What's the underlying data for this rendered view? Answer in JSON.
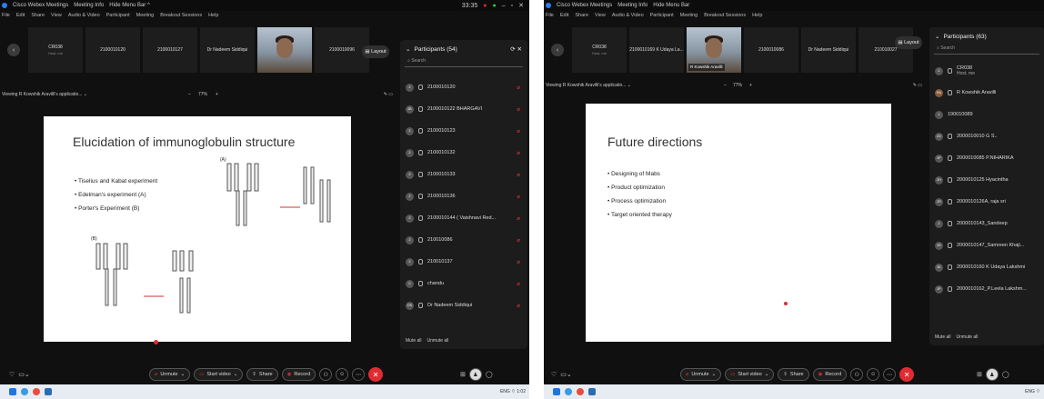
{
  "left": {
    "title": "Cisco Webex Meetings",
    "meeting_info": "Meeting Info",
    "hide_menu": "Hide Menu Bar ^",
    "timer": "33:35",
    "menus": [
      "File",
      "Edit",
      "Share",
      "View",
      "Audio & Video",
      "Participant",
      "Meeting",
      "Breakout Sessions",
      "Help"
    ],
    "thumbs": [
      {
        "name": "CR038",
        "sub": "Host, me"
      },
      {
        "name": "2100010120",
        "sub": ""
      },
      {
        "name": "2100010127",
        "sub": ""
      },
      {
        "name": "Dr Nadeem Siddiqui",
        "sub": ""
      },
      {
        "name": "",
        "sub": "",
        "video": true
      },
      {
        "name": "2100010096",
        "sub": ""
      }
    ],
    "layout": "Layout",
    "viewing": "Viewing R Kowshik Aravilli's applicatio...",
    "zoom": "77%",
    "slide": {
      "title": "Elucidation of immunoglobulin structure",
      "bullets": [
        "Tiselius and Kabat experiment",
        "Edelman's experiment (A)",
        "Porter's Experiment (B)"
      ],
      "label_a": "(A)",
      "label_b": "(B)"
    },
    "participants": {
      "header": "Participants (54)",
      "search": "Search",
      "rows": [
        "2100010120",
        "2100010122 BHARGAVI",
        "2100010123",
        "2100010132",
        "2100010133",
        "2100010136",
        "2100010144 ( Vaishnavi Red...",
        "210010086",
        "210010137",
        "chandu",
        "Dr Nadeem Siddiqui"
      ],
      "mute_all": "Mute all",
      "unmute_all": "Unmute all"
    },
    "controls": {
      "unmute": "Unmute",
      "start_video": "Start video",
      "share": "Share",
      "record": "Record"
    },
    "clock_time": "1:02",
    "clock_lang": "ENG"
  },
  "right": {
    "title": "Cisco Webex Meetings",
    "meeting_info": "Meeting Info",
    "hide_menu": "Hide Menu Bar",
    "menus": [
      "File",
      "Edit",
      "Share",
      "View",
      "Audio & Video",
      "Participant",
      "Meeting",
      "Breakout Sessions",
      "Help"
    ],
    "thumbs": [
      {
        "name": "CR038",
        "sub": "Host, me"
      },
      {
        "name": "2100010169 K Udaya La...",
        "sub": ""
      },
      {
        "name": "",
        "sub": "",
        "video": true,
        "cap": "R Kowshik Aravilli"
      },
      {
        "name": "2100010086",
        "sub": ""
      },
      {
        "name": "Dr Nadeem Siddiqui",
        "sub": ""
      },
      {
        "name": "210010027",
        "sub": ""
      }
    ],
    "layout": "Layout",
    "viewing": "Viewing R Kowshik Aravilli's applicatio...",
    "zoom": "77%",
    "slide": {
      "title": "Future directions",
      "bullets": [
        "Designing of Mabs",
        "Product optimization",
        "Process optimization",
        "Target oriented therapy"
      ]
    },
    "participants": {
      "header": "Participants (63)",
      "search": "Search",
      "rows": [
        "CR038",
        "R Kowshik Aravilli",
        "190010089",
        "2000010010 G S..",
        "2000010085 P.NIHARIKA",
        "2000010125 Hyacintha",
        "2000010126A, raja sri",
        "2000010143_Sandeep",
        "2000010147_Samreen Khaji...",
        "2000010160 K Udaya Lakshmi",
        "2000010162_P.Leela Lakshm..."
      ],
      "row_subs": {
        "0": "Host, me"
      },
      "mute_all": "Mute all",
      "unmute_all": "Unmute all"
    },
    "controls": {
      "unmute": "Unmute",
      "start_video": "Start video",
      "share": "Share",
      "record": "Record"
    },
    "clock_lang": "ENG"
  }
}
